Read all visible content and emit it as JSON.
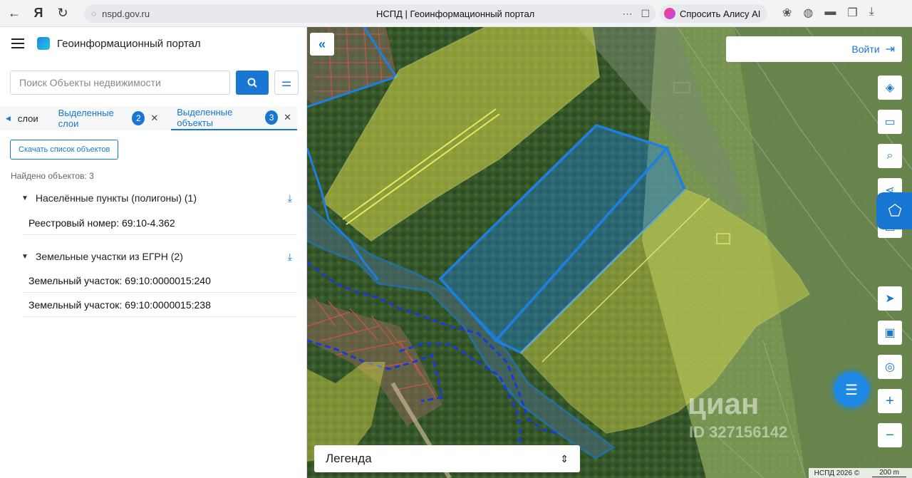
{
  "browser": {
    "url": "nspd.gov.ru",
    "tab_title": "НСПД | Геоинформационный портал",
    "alice_label": "Спросить Алису AI"
  },
  "sidebar": {
    "portal_title": "Геоинформационный портал",
    "search_placeholder": "Поиск Объекты недвижимости",
    "tabs": [
      {
        "label": "слои"
      },
      {
        "label": "Выделенные слои",
        "count": "2"
      },
      {
        "label": "Выделенные объекты",
        "count": "3"
      }
    ],
    "download_label": "Скачать список объектов",
    "found_text": "Найдено объектов: 3",
    "groups": [
      {
        "title": "Населённые пункты (полигоны) (1)",
        "items": [
          "Реестровый номер: 69:10-4.362"
        ]
      },
      {
        "title": "Земельные участки из ЕГРН (2)",
        "items": [
          "Земельный участок: 69:10:0000015:240",
          "Земельный участок: 69:10:0000015:238"
        ]
      }
    ]
  },
  "map": {
    "login_label": "Войти",
    "legend_label": "Легенда",
    "watermark": "циан",
    "watermark_id": "ID 327156142",
    "attribution": "НСПД 2026 ©",
    "scale": "200 m",
    "colors": {
      "accent": "#1976d2",
      "selected_parcel": "#1e7fe0",
      "yellow_zone": "#d8d84a"
    }
  }
}
